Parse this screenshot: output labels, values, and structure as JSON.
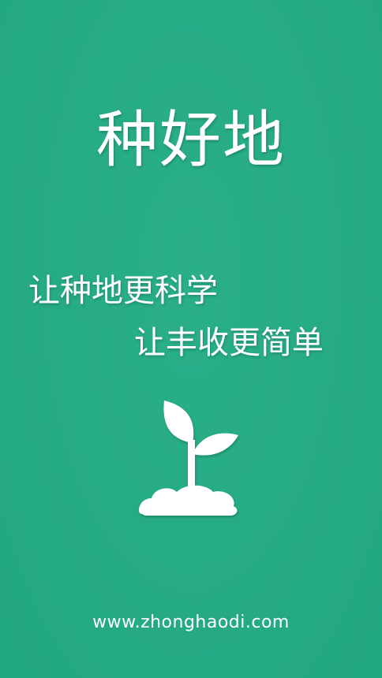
{
  "splash": {
    "app_title": "种好地",
    "slogan_line_1": "让种地更科学",
    "slogan_line_2": "让丰收更简单",
    "logo_icon": "sprout-icon",
    "website": "www.zhonghaodi.com"
  },
  "colors": {
    "background": "#23ad85",
    "text": "#ffffff"
  }
}
